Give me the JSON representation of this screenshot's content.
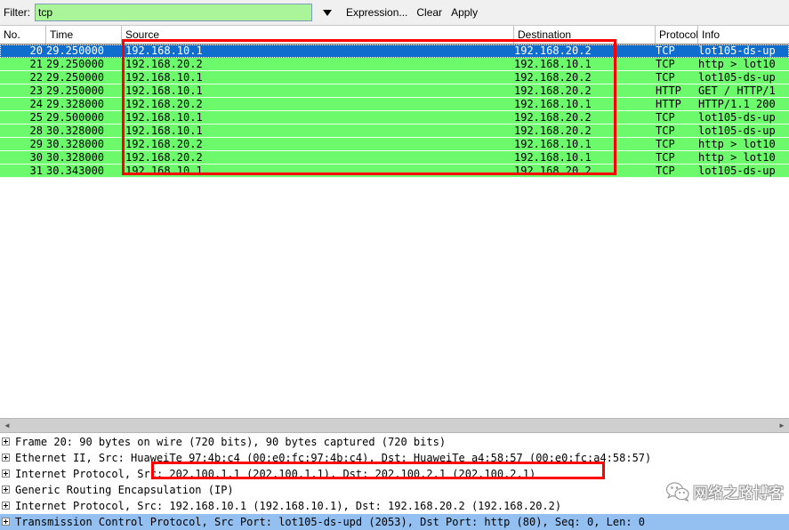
{
  "filter_bar": {
    "label": "Filter:",
    "value": "tcp",
    "placeholder": "",
    "dropdown_icon": "chevron-down-icon",
    "expression_label": "Expression...",
    "clear_label": "Clear",
    "apply_label": "Apply"
  },
  "packet_list": {
    "columns": [
      {
        "key": "no",
        "label": "No."
      },
      {
        "key": "time",
        "label": "Time"
      },
      {
        "key": "src",
        "label": "Source"
      },
      {
        "key": "dst",
        "label": "Destination"
      },
      {
        "key": "pro",
        "label": "Protocol"
      },
      {
        "key": "info",
        "label": "Info"
      }
    ],
    "rows": [
      {
        "no": "20",
        "time": "29.250000",
        "src": "192.168.10.1",
        "dst": "192.168.20.2",
        "pro": "TCP",
        "info": "lot105-ds-up",
        "state": "selected"
      },
      {
        "no": "21",
        "time": "29.250000",
        "src": "192.168.20.2",
        "dst": "192.168.10.1",
        "pro": "TCP",
        "info": "http > lot10",
        "state": "normal"
      },
      {
        "no": "22",
        "time": "29.250000",
        "src": "192.168.10.1",
        "dst": "192.168.20.2",
        "pro": "TCP",
        "info": "lot105-ds-up",
        "state": "normal"
      },
      {
        "no": "23",
        "time": "29.250000",
        "src": "192.168.10.1",
        "dst": "192.168.20.2",
        "pro": "HTTP",
        "info": "GET / HTTP/1",
        "state": "normal"
      },
      {
        "no": "24",
        "time": "29.328000",
        "src": "192.168.20.2",
        "dst": "192.168.10.1",
        "pro": "HTTP",
        "info": "HTTP/1.1 200",
        "state": "normal"
      },
      {
        "no": "25",
        "time": "29.500000",
        "src": "192.168.10.1",
        "dst": "192.168.20.2",
        "pro": "TCP",
        "info": "lot105-ds-up",
        "state": "normal"
      },
      {
        "no": "28",
        "time": "30.328000",
        "src": "192.168.10.1",
        "dst": "192.168.20.2",
        "pro": "TCP",
        "info": "lot105-ds-up",
        "state": "normal"
      },
      {
        "no": "29",
        "time": "30.328000",
        "src": "192.168.20.2",
        "dst": "192.168.10.1",
        "pro": "TCP",
        "info": "http > lot10",
        "state": "normal"
      },
      {
        "no": "30",
        "time": "30.328000",
        "src": "192.168.20.2",
        "dst": "192.168.10.1",
        "pro": "TCP",
        "info": "http > lot10",
        "state": "normal"
      },
      {
        "no": "31",
        "time": "30.343000",
        "src": "192.168.10.1",
        "dst": "192.168.20.2",
        "pro": "TCP",
        "info": "lot105-ds-up",
        "state": "normal"
      }
    ]
  },
  "detail_pane": {
    "rows": [
      {
        "text": "Frame 20: 90 bytes on wire (720 bits), 90 bytes captured (720 bits)",
        "state": "normal"
      },
      {
        "text": "Ethernet II, Src: HuaweiTe_97:4b:c4 (00:e0:fc:97:4b:c4), Dst: HuaweiTe_a4:58:57 (00:e0:fc:a4:58:57)",
        "state": "normal"
      },
      {
        "text": "Internet Protocol, Src: 202.100.1.1 (202.100.1.1), Dst: 202.100.2.1 (202.100.2.1)",
        "state": "normal"
      },
      {
        "text": "Generic Routing Encapsulation (IP)",
        "state": "normal"
      },
      {
        "text": "Internet Protocol, Src: 192.168.10.1 (192.168.10.1), Dst: 192.168.20.2 (192.168.20.2)",
        "state": "normal"
      },
      {
        "text": "Transmission Control Protocol, Src Port: lot105-ds-upd (2053), Dst Port: http (80), Seq: 0, Len: 0",
        "state": "selected"
      }
    ]
  },
  "annotations": [
    {
      "id": "packets",
      "name": "red-highlight-box-addresses"
    },
    {
      "id": "ip",
      "name": "red-highlight-box-outer-ip"
    }
  ],
  "watermark": {
    "text": "网络之路博客",
    "logo_icon": "wechat-logo-icon"
  },
  "colors": {
    "row_green": "#6cf96c",
    "row_selected": "#0f6ecd",
    "filter_field": "#aaf599",
    "annotation_red": "#ff0000",
    "detail_selected": "#93c0f0"
  }
}
